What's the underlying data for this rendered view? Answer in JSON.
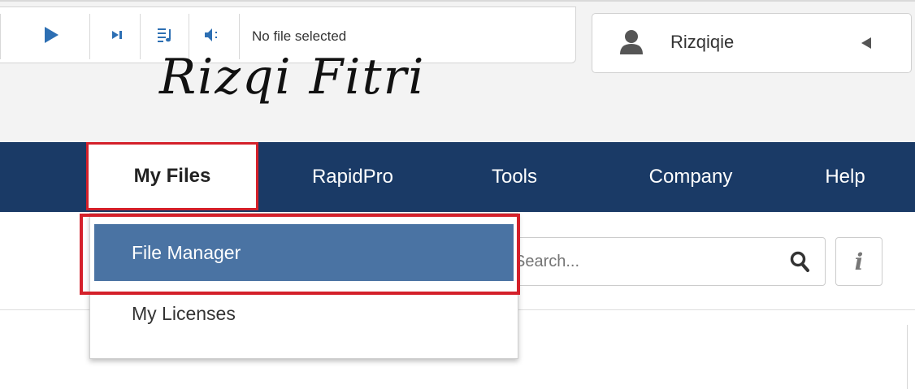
{
  "player": {
    "status_text": "No file selected",
    "accent_color": "#2d6fb3",
    "icons": [
      "play-icon",
      "next-track-icon",
      "playlist-icon",
      "volume-icon"
    ]
  },
  "user": {
    "name": "Rizqiqie",
    "avatar_icon": "user-silhouette-icon",
    "collapse_icon": "triangle-left-icon"
  },
  "signature": {
    "text": "Rizqi Fitri"
  },
  "nav": {
    "tabs": [
      {
        "label": "My Files",
        "active": true
      },
      {
        "label": "RapidPro"
      },
      {
        "label": "Tools"
      },
      {
        "label": "Company"
      },
      {
        "label": "Help"
      }
    ],
    "background_color": "#1a3a66"
  },
  "dropdown": {
    "items": [
      {
        "label": "File Manager",
        "selected": true
      },
      {
        "label": "My Licenses"
      }
    ],
    "highlight_color": "#4a73a3",
    "annotation_color": "#d4202a"
  },
  "search": {
    "placeholder": "Search...",
    "icon": "magnifier-icon",
    "info_label": "i"
  }
}
